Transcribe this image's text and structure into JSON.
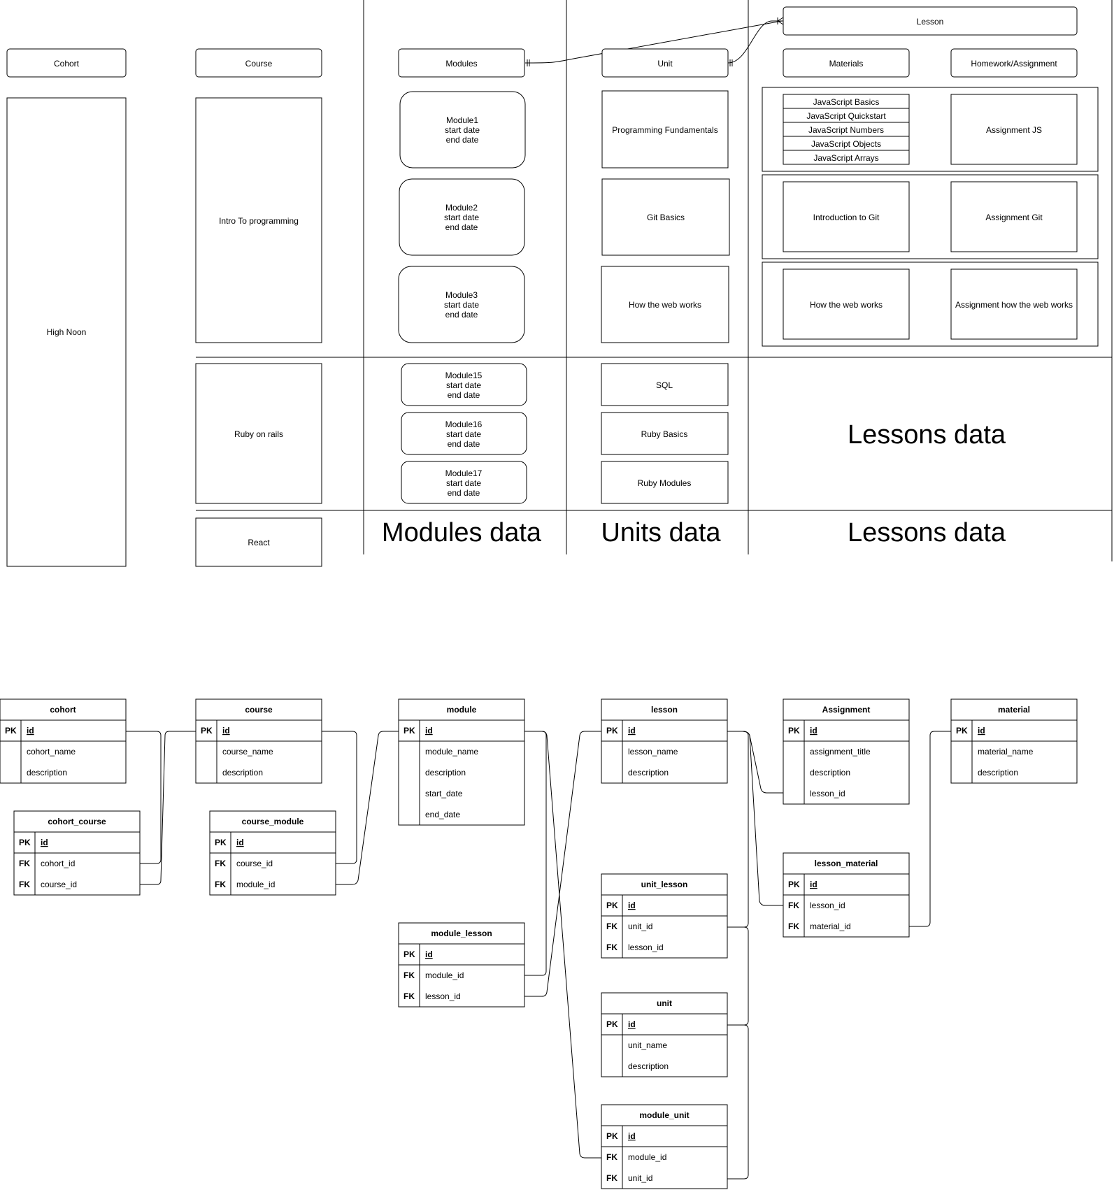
{
  "headers": {
    "cohort": "Cohort",
    "course": "Course",
    "modules": "Modules",
    "unit": "Unit",
    "lesson": "Lesson",
    "materials": "Materials",
    "homework": "Homework/Assignment"
  },
  "cohort": {
    "name": "High Noon"
  },
  "courses": {
    "c1": "Intro To programming",
    "c2": "Ruby on rails",
    "c3": "React"
  },
  "modules": {
    "m1": [
      "Module1",
      "start date",
      "end date"
    ],
    "m2": [
      "Module2",
      "start date",
      "end date"
    ],
    "m3": [
      "Module3",
      "start date",
      "end date"
    ],
    "m15": [
      "Module15",
      "start date",
      "end date"
    ],
    "m16": [
      "Module16",
      "start date",
      "end date"
    ],
    "m17": [
      "Module17",
      "start date",
      "end date"
    ]
  },
  "units": {
    "u1": "Programming Fundamentals",
    "u2": "Git Basics",
    "u3": "How the web works",
    "u4": "SQL",
    "u5": "Ruby Basics",
    "u6": "Ruby Modules"
  },
  "materials": {
    "js_list": [
      "JavaScript Basics",
      "JavaScript Quickstart",
      "JavaScript Numbers",
      "JavaScript Objects",
      "JavaScript Arrays"
    ],
    "git": "Introduction to Git",
    "web": "How the web works"
  },
  "assignments": {
    "js": "Assignment JS",
    "git": "Assignment Git",
    "web": "Assignment how the web works"
  },
  "placeholders": {
    "lessons_data": "Lessons data",
    "modules_data": "Modules data",
    "units_data": "Units data"
  },
  "er_tables": [
    {
      "id": "cohort",
      "title": "cohort",
      "rows": [
        [
          "PK",
          "id"
        ],
        [
          "",
          "cohort_name"
        ],
        [
          "",
          "description"
        ]
      ]
    },
    {
      "id": "cohort_course",
      "title": "cohort_course",
      "rows": [
        [
          "PK",
          "id"
        ],
        [
          "FK",
          "cohort_id"
        ],
        [
          "FK",
          "course_id"
        ]
      ]
    },
    {
      "id": "course",
      "title": "course",
      "rows": [
        [
          "PK",
          "id"
        ],
        [
          "",
          "course_name"
        ],
        [
          "",
          "description"
        ]
      ]
    },
    {
      "id": "course_module",
      "title": "course_module",
      "rows": [
        [
          "PK",
          "id"
        ],
        [
          "FK",
          "course_id"
        ],
        [
          "FK",
          "module_id"
        ]
      ]
    },
    {
      "id": "module",
      "title": "module",
      "rows": [
        [
          "PK",
          "id"
        ],
        [
          "",
          "module_name"
        ],
        [
          "",
          "description"
        ],
        [
          "",
          "start_date"
        ],
        [
          "",
          "end_date"
        ]
      ]
    },
    {
      "id": "module_lesson",
      "title": "module_lesson",
      "rows": [
        [
          "PK",
          "id"
        ],
        [
          "FK",
          "module_id"
        ],
        [
          "FK",
          "lesson_id"
        ]
      ]
    },
    {
      "id": "lesson",
      "title": "lesson",
      "rows": [
        [
          "PK",
          "id"
        ],
        [
          "",
          "lesson_name"
        ],
        [
          "",
          "description"
        ]
      ]
    },
    {
      "id": "unit_lesson",
      "title": "unit_lesson",
      "rows": [
        [
          "PK",
          "id"
        ],
        [
          "FK",
          "unit_id"
        ],
        [
          "FK",
          "lesson_id"
        ]
      ]
    },
    {
      "id": "unit",
      "title": "unit",
      "rows": [
        [
          "PK",
          "id"
        ],
        [
          "",
          "unit_name"
        ],
        [
          "",
          "description"
        ]
      ]
    },
    {
      "id": "module_unit",
      "title": "module_unit",
      "rows": [
        [
          "PK",
          "id"
        ],
        [
          "FK",
          "module_id"
        ],
        [
          "FK",
          "unit_id"
        ]
      ]
    },
    {
      "id": "assignment",
      "title": "Assignment",
      "rows": [
        [
          "PK",
          "id"
        ],
        [
          "",
          "assignment_title"
        ],
        [
          "",
          "description"
        ],
        [
          "",
          "lesson_id"
        ]
      ]
    },
    {
      "id": "lesson_material",
      "title": "lesson_material",
      "rows": [
        [
          "PK",
          "id"
        ],
        [
          "FK",
          "lesson_id"
        ],
        [
          "FK",
          "material_id"
        ]
      ]
    },
    {
      "id": "material",
      "title": "material",
      "rows": [
        [
          "PK",
          "id"
        ],
        [
          "",
          "material_name"
        ],
        [
          "",
          "description"
        ]
      ]
    }
  ]
}
